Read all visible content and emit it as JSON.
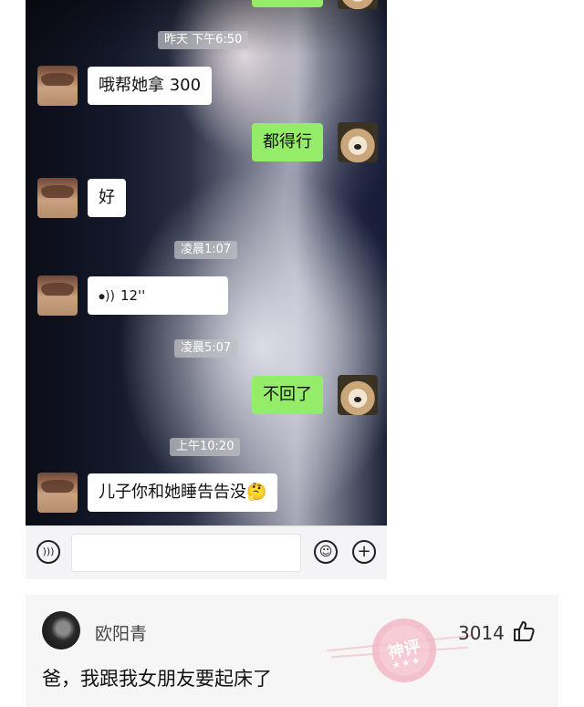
{
  "chat": {
    "timestamps": [
      "昨天 下午6:50",
      "凌晨1:07",
      "凌晨5:07",
      "上午10:20"
    ],
    "messages": [
      {
        "side": "left",
        "text": "哦帮她拿 300"
      },
      {
        "side": "right",
        "text": "都得行"
      },
      {
        "side": "left",
        "text": "好"
      },
      {
        "side": "left",
        "type": "voice",
        "text": "12''"
      },
      {
        "side": "right",
        "text": "不回了"
      },
      {
        "side": "left",
        "text": "儿子你和她睡告告没🤔"
      }
    ]
  },
  "input_bar": {
    "voice_icon": "voice-icon",
    "emoji_icon": "emoji-icon",
    "plus_icon": "plus-icon"
  },
  "comment": {
    "username": "欧阳青",
    "likes": "3014",
    "text": "爸，我跟我女朋友要起床了",
    "badge": "神评",
    "badge_color": "#f4b6c6"
  }
}
